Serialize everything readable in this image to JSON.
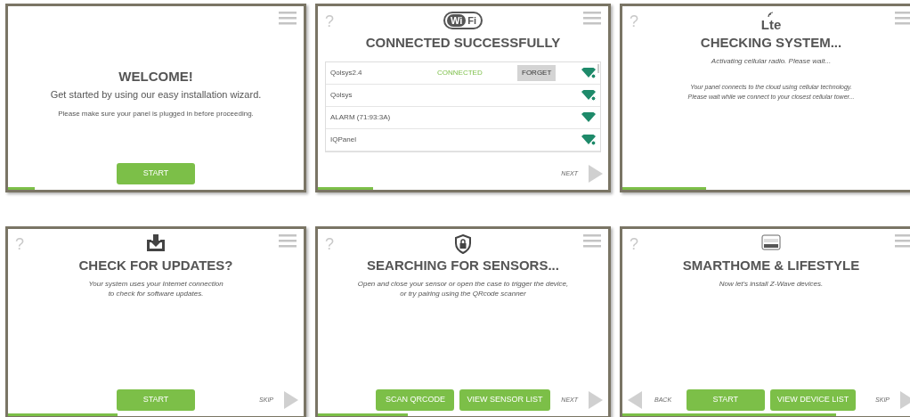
{
  "panels": [
    {
      "title": "WELCOME!",
      "lines": [
        {
          "text": "Get started by using our easy installation wizard.",
          "kind": "lead"
        },
        {
          "text": "Please make sure your panel is plugged in before proceeding.",
          "kind": "note"
        }
      ],
      "buttons": [
        "START"
      ],
      "progress": {
        "level": 0.09
      }
    },
    {
      "help": "?",
      "logo": {
        "kind": "wifi",
        "parts": [
          "Wi",
          "Fi"
        ]
      },
      "title": "CONNECTED SUCCESSFULLY",
      "networks": [
        {
          "name": "Qolsys2.4",
          "status": "CONNECTED",
          "action": "FORGET",
          "locked": true
        },
        {
          "name": "Qolsys",
          "locked": true
        },
        {
          "name": "ALARM (71:93:3A)",
          "locked": false
        },
        {
          "name": "IQPanel",
          "locked": true
        }
      ],
      "forward": {
        "label": "NEXT"
      },
      "progress": {
        "level": 0.19
      }
    },
    {
      "help": "?",
      "logo": {
        "kind": "lte",
        "parts": [
          "Lte"
        ]
      },
      "title": "CHECKING SYSTEM...",
      "lines": [
        {
          "text": "Activating cellular radio. Please wait...",
          "kind": "hint"
        },
        {
          "text": "Your panel connects to the cloud using cellular technology.\nPlease wait while we connect to your closest cellular tower...",
          "kind": "detail"
        }
      ],
      "progress": {
        "level": 0.28
      }
    },
    {
      "help": "?",
      "logo": {
        "kind": "download"
      },
      "title": "CHECK FOR UPDATES?",
      "lines": [
        {
          "text": "Your system uses your Internet connection\nto check for software updates.",
          "kind": "hint"
        }
      ],
      "buttons": [
        "START"
      ],
      "forward": {
        "label": "SKIP"
      },
      "progress": {
        "level": 0.37
      }
    },
    {
      "help": "?",
      "logo": {
        "kind": "shield"
      },
      "title": "SEARCHING FOR SENSORS...",
      "lines": [
        {
          "text": "Open and close your sensor or open the case to trigger the device,\nor try pairing using the QRcode scanner",
          "kind": "hint"
        }
      ],
      "buttons": [
        "SCAN QRCODE",
        "VIEW SENSOR LIST"
      ],
      "forward": {
        "label": "NEXT"
      },
      "progress": {
        "level": 0.31
      }
    },
    {
      "help": "?",
      "logo": {
        "kind": "zwave"
      },
      "title": "SMARTHOME & LIFESTYLE",
      "lines": [
        {
          "text": "Now let's install Z-Wave devices.",
          "kind": "hint"
        }
      ],
      "buttons": [
        "START",
        "VIEW DEVICE LIST"
      ],
      "back": {
        "label": "BACK"
      },
      "forward": {
        "label": "SKIP"
      },
      "progress": {
        "level": 0.72
      }
    }
  ]
}
